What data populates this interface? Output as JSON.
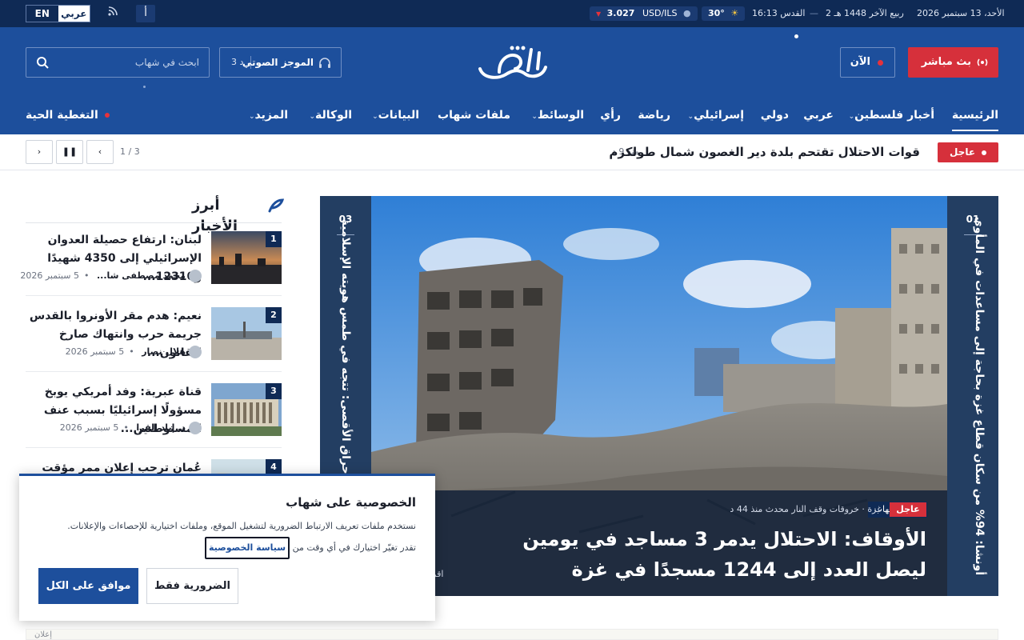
{
  "topbar": {
    "date": "الأحد، 13 سبتمبر 2026",
    "hijri": "2 ربيع الآخر 1448 هـ",
    "city_time": "القدس 16:13",
    "weather_temp": "30°",
    "currency_pair": "USD/ILS",
    "currency_value": "3.027",
    "font_size_label": "أ",
    "lang_en": "EN",
    "lang_ar": "عربي"
  },
  "header": {
    "search_placeholder": "ابحث في شهاب",
    "audio_label": "الموجز الصوتي",
    "audio_duration": "3 د",
    "logo_text": "شهاب",
    "now_label": "الآن",
    "live_label": "بث مباشر"
  },
  "nav": {
    "items": [
      "الرئيسية",
      "أخبار فلسطين",
      "عربي",
      "دولي",
      "إسرائيلي",
      "رياضة",
      "رأي",
      "الوسائط",
      "ملفات شهاب",
      "البيانات",
      "الوكالة",
      "المزيد"
    ],
    "live_coverage": "التغطية الحية"
  },
  "ticker": {
    "badge": "عاجل",
    "headline": "قوات الاحتلال تقتحم بلدة دير الغصون شمال طولكرم",
    "time": "منذ 9 د",
    "count": "1 / 3"
  },
  "top_news": {
    "title": "أبرز الأخبار",
    "items": [
      {
        "num": "1",
        "title": "لبنان: ارتفاع حصيلة العدوان الإسرائيلي إلى 4350 شهيدًا و12310...",
        "author": "محمد مصطفى شا...",
        "date": "5 سبتمبر 2026"
      },
      {
        "num": "2",
        "title": "نعيم: هدم مقر الأونروا بالقدس جريمة حرب وانتهاك صارخ للقانون...",
        "author": "هلال نصار",
        "date": "5 سبتمبر 2026"
      },
      {
        "num": "3",
        "title": "قناة عبرية: وفد أمريكي يوبخ مسؤولًا إسرائيليًا بسبب عنف المستوطنين...",
        "author": "د. إياد القرا",
        "date": "5 سبتمبر 2026"
      },
      {
        "num": "4",
        "title": "عُمان ترحب إعلان ممر مؤقت في",
        "author": "",
        "date": ""
      }
    ]
  },
  "hero": {
    "left_no": "03",
    "left_title": "حماس في ذكرى إحراق الأقصى: تتجه في طمس هويته الإسلامية",
    "right_no": "01",
    "right_title": "أونشا: 94% من سكان قطاع غزة بحاجة إلى مساعدات في المأوى",
    "tag": "متابعة شهاب",
    "urgent": "عاجل",
    "meta": "غزة · خروقات وقف النار   محدث منذ 44 د",
    "headline": "الأوقاف: الاحتلال يدمر 3 مساجد في يومين ليصل العدد إلى 1244 مسجدًا في غزة",
    "more": "اقر"
  },
  "cookie": {
    "title": "الخصوصية على شهاب",
    "text1": "نستخدم ملفات تعريف الارتباط الضرورية لتشغيل الموقع، وملفات اختيارية للإحصاءات والإعلانات.",
    "text2": "تقدر تغيّر اختيارك في أي وقت من",
    "policy_link": "سياسة الخصوصية",
    "btn_necessary": "الضرورية فقط",
    "btn_accept": "موافق على الكل"
  },
  "ad": {
    "label": "إعلان"
  },
  "colors": {
    "primary": "#1d4f9c",
    "dark": "#0f2a55",
    "accent_red": "#d6303b"
  }
}
